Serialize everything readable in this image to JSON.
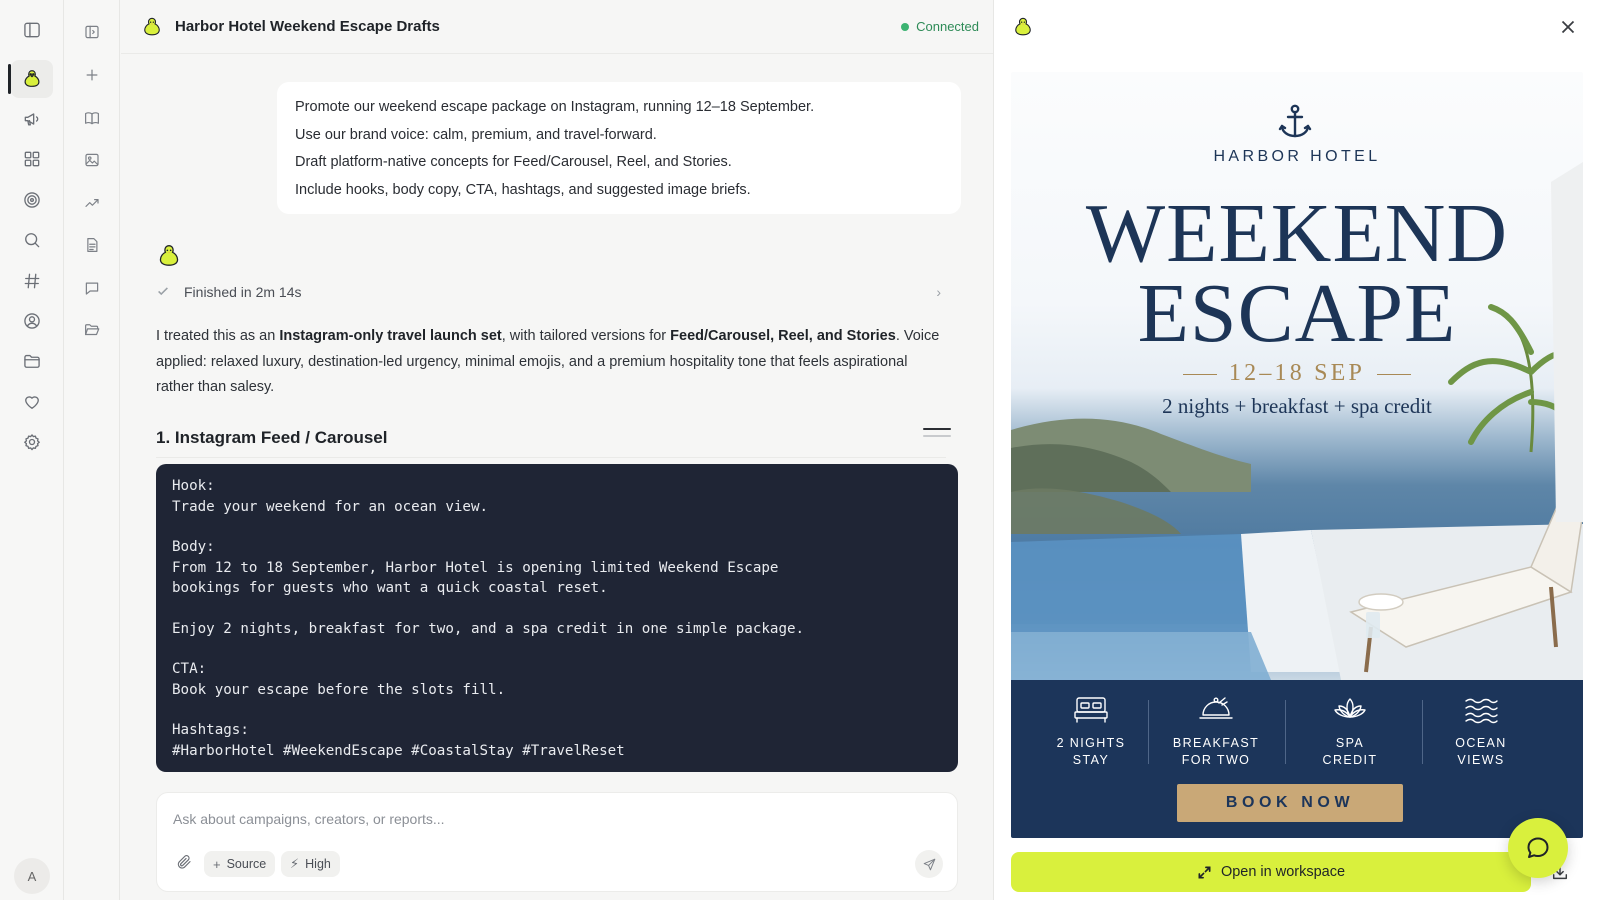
{
  "app": {
    "rail": {
      "items": [
        {
          "name": "sidebar-toggle",
          "icon": "panel-left-icon"
        },
        {
          "name": "assistant",
          "icon": "duck-icon",
          "active": true
        },
        {
          "name": "campaigns",
          "icon": "megaphone-icon"
        },
        {
          "name": "dashboard",
          "icon": "grid-icon"
        },
        {
          "name": "goals",
          "icon": "target-icon"
        },
        {
          "name": "search",
          "icon": "search-icon"
        },
        {
          "name": "channels",
          "icon": "hash-icon"
        },
        {
          "name": "creators",
          "icon": "user-circle-icon"
        },
        {
          "name": "files",
          "icon": "folder-icon"
        },
        {
          "name": "favorites",
          "icon": "heart-icon"
        },
        {
          "name": "settings",
          "icon": "gear-icon"
        }
      ],
      "avatar_initial": "A"
    },
    "rail2": {
      "items": [
        {
          "name": "panel-collapse",
          "icon": "panel-right-icon"
        },
        {
          "name": "new",
          "icon": "plus-icon"
        },
        {
          "name": "library",
          "icon": "book-icon"
        },
        {
          "name": "images",
          "icon": "image-icon"
        },
        {
          "name": "trends",
          "icon": "trend-icon"
        },
        {
          "name": "documents",
          "icon": "document-icon"
        },
        {
          "name": "messages",
          "icon": "chat-icon"
        },
        {
          "name": "folders",
          "icon": "folder-open-icon"
        }
      ]
    }
  },
  "chat": {
    "title": "Harbor Hotel Weekend Escape Drafts",
    "status": "Connected",
    "status_color": "#2e8b57",
    "user_message": [
      "Promote our weekend escape package on Instagram, running 12–18 September.",
      "Use our brand voice: calm, premium, and travel-forward.",
      "Draft platform-native concepts for Feed/Carousel, Reel, and Stories.",
      "Include hooks, body copy, CTA, hashtags, and suggested image briefs."
    ],
    "finished_label": "Finished in 2m 14s",
    "reply": {
      "p1": "I treated this as an ",
      "b1": "Instagram-only travel launch set",
      "p2": ", with tailored versions for ",
      "b2": "Feed/Carousel, Reel, and Stories",
      "p3": ". Voice applied: relaxed luxury, destination-led urgency, minimal emojis, and a premium hospitality tone that feels aspirational rather than salesy."
    },
    "section_heading": "1. Instagram Feed / Carousel",
    "code": {
      "hook_label": "Hook:",
      "hook": "Trade your weekend for an ocean view.",
      "body_label": "Body:",
      "body_line1": "From 12 to 18 September, Harbor Hotel is opening limited Weekend Escape",
      "body_line2": "bookings for guests who want a quick coastal reset.",
      "body_line3": "Enjoy 2 nights, breakfast for two, and a spa credit in one simple package.",
      "cta_label": "CTA:",
      "cta": "Book your escape before the slots fill.",
      "hashtags_label": "Hashtags:",
      "hashtags": "#HarborHotel #WeekendEscape #CoastalStay #TravelReset"
    },
    "composer": {
      "placeholder": "Ask about campaigns, creators, or reports...",
      "source_chip": "Source",
      "priority_chip": "High"
    }
  },
  "preview": {
    "poster": {
      "brand": "HARBOR HOTEL",
      "headline_1": "WEEKEND",
      "headline_2": "ESCAPE",
      "dates": "12–18 SEP",
      "tagline": "2 nights + breakfast + spa credit",
      "features": [
        {
          "l1": "2 NIGHTS",
          "l2": "STAY",
          "icon": "bed-icon"
        },
        {
          "l1": "BREAKFAST",
          "l2": "FOR TWO",
          "icon": "cloche-icon"
        },
        {
          "l1": "SPA",
          "l2": "CREDIT",
          "icon": "lotus-icon"
        },
        {
          "l1": "OCEAN",
          "l2": "VIEWS",
          "icon": "waves-icon"
        }
      ],
      "cta": "BOOK NOW",
      "navy": "#1c355a",
      "gold": "#c9a877"
    },
    "open_button": "Open in workspace",
    "accent": "#d9f03d"
  }
}
